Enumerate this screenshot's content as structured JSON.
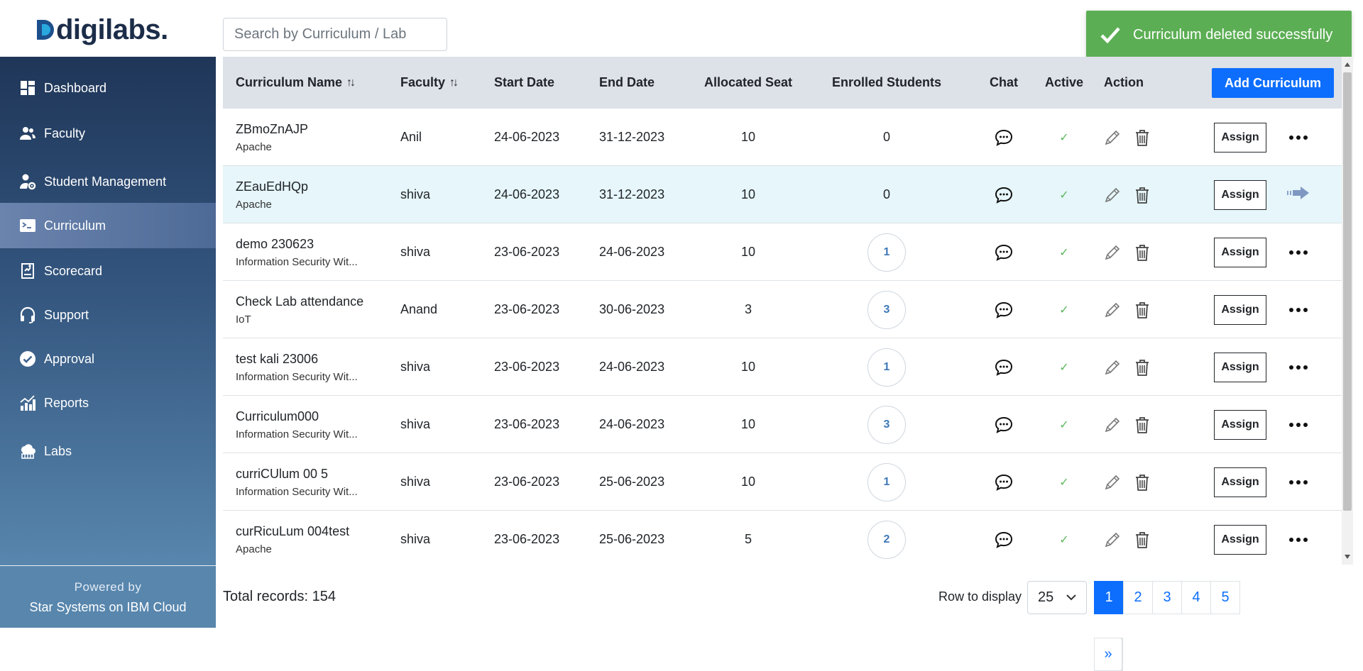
{
  "app": {
    "logo_text": "digilabs."
  },
  "search": {
    "placeholder": "Search by Curriculum / Lab"
  },
  "toast": {
    "message": "Curriculum deleted successfully"
  },
  "sidebar": {
    "items": [
      {
        "label": "Dashboard",
        "icon": "dashboard-icon",
        "active": false
      },
      {
        "label": "Faculty",
        "icon": "users-icon",
        "active": false
      },
      {
        "label": "Student Management",
        "icon": "user-gear-icon",
        "active": false
      },
      {
        "label": "Curriculum",
        "icon": "terminal-icon",
        "active": true
      },
      {
        "label": "Scorecard",
        "icon": "scorecard-icon",
        "active": false
      },
      {
        "label": "Support",
        "icon": "headset-icon",
        "active": false
      },
      {
        "label": "Approval",
        "icon": "check-circle-icon",
        "active": false
      },
      {
        "label": "Reports",
        "icon": "bar-chart-icon",
        "active": false
      },
      {
        "label": "Labs",
        "icon": "cloud-lab-icon",
        "active": false
      }
    ],
    "powered_by": "Powered by",
    "powered_org": "Star Systems on IBM Cloud"
  },
  "table": {
    "headers": {
      "name": "Curriculum Name",
      "faculty": "Faculty",
      "start": "Start Date",
      "end": "End Date",
      "seat": "Allocated Seat",
      "enrolled": "Enrolled Students",
      "chat": "Chat",
      "active": "Active",
      "action": "Action"
    },
    "sort_glyph": "↑↓",
    "add_label": "Add Curriculum",
    "assign_label": "Assign",
    "check_glyph": "✓",
    "rows": [
      {
        "name": "ZBmoZnAJP",
        "sub": "Apache",
        "faculty": "Anil",
        "start": "24-06-2023",
        "end": "31-12-2023",
        "seat": "10",
        "enrolled": "0",
        "circle": false,
        "highlight": false
      },
      {
        "name": "ZEauEdHQp",
        "sub": "Apache",
        "faculty": "shiva",
        "start": "24-06-2023",
        "end": "31-12-2023",
        "seat": "10",
        "enrolled": "0",
        "circle": false,
        "highlight": true
      },
      {
        "name": "demo 230623",
        "sub": "Information Security Wit...",
        "faculty": "shiva",
        "start": "23-06-2023",
        "end": "24-06-2023",
        "seat": "10",
        "enrolled": "1",
        "circle": true,
        "highlight": false
      },
      {
        "name": "Check Lab attendance",
        "sub": "IoT",
        "faculty": "Anand",
        "start": "23-06-2023",
        "end": "30-06-2023",
        "seat": "3",
        "enrolled": "3",
        "circle": true,
        "highlight": false
      },
      {
        "name": "test kali 23006",
        "sub": "Information Security Wit...",
        "faculty": "shiva",
        "start": "23-06-2023",
        "end": "24-06-2023",
        "seat": "10",
        "enrolled": "1",
        "circle": true,
        "highlight": false
      },
      {
        "name": "Curriculum000",
        "sub": "Information Security Wit...",
        "faculty": "shiva",
        "start": "23-06-2023",
        "end": "24-06-2023",
        "seat": "10",
        "enrolled": "3",
        "circle": true,
        "highlight": false
      },
      {
        "name": "curriCUlum 00 5",
        "sub": "Information Security Wit...",
        "faculty": "shiva",
        "start": "23-06-2023",
        "end": "25-06-2023",
        "seat": "10",
        "enrolled": "1",
        "circle": true,
        "highlight": false
      },
      {
        "name": "curRicuLum 004test",
        "sub": "Apache",
        "faculty": "shiva",
        "start": "23-06-2023",
        "end": "25-06-2023",
        "seat": "5",
        "enrolled": "2",
        "circle": true,
        "highlight": false
      }
    ]
  },
  "footer": {
    "total_records": "Total records: 154",
    "rows_label": "Row to display",
    "rows_value": "25",
    "pages": [
      "«",
      "‹",
      "1",
      "2",
      "3",
      "4",
      "5",
      "›",
      "»"
    ],
    "current_page": "1"
  },
  "colors": {
    "primary": "#0d6efd",
    "toast_green": "#5cae54",
    "sidebar_top": "#1f3658",
    "sidebar_bottom": "#5886ad",
    "highlight_row": "#e6f6fa"
  }
}
